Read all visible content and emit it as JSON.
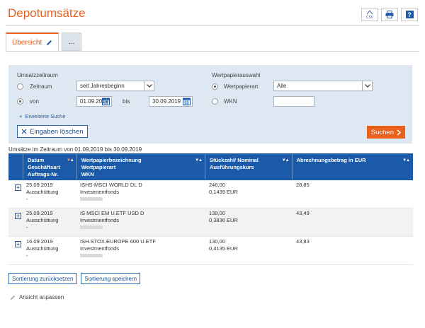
{
  "page": {
    "title": "Depotumsätze"
  },
  "toolbar": {
    "csv_label": "CSV"
  },
  "tabs": [
    {
      "label": "Übersicht"
    },
    {
      "label": "..."
    }
  ],
  "filter": {
    "period_label": "Umsatzzeitraum",
    "range_label": "Zeitraum",
    "range_value": "seit Jahresbeginn",
    "from_label": "von",
    "from_value": "01.09.2019",
    "to_label": "bis",
    "to_value": "30.09.2019",
    "security_label": "Wertpapierauswahl",
    "security_type_label": "Wertpapierart",
    "security_type_value": "Alle",
    "wkn_label": "WKN",
    "wkn_value": "",
    "extended_search": "Erweiterte Suche",
    "clear_label": "Eingaben löschen",
    "search_label": "Suchen"
  },
  "results": {
    "range_text": "Umsätze im Zeitraum von 01.09.2019 bis 30.09.2019"
  },
  "table": {
    "headers": [
      {
        "lines": [
          "Datum",
          "Geschäftsart",
          "Auftrags-Nr."
        ]
      },
      {
        "lines": [
          "Wertpapierbezeichnung",
          "Wertpapierart",
          "WKN"
        ]
      },
      {
        "lines": [
          "Stückzahl/ Nominal",
          "Ausführungskurs"
        ]
      },
      {
        "lines": [
          "Abrechnungsbetrag in EUR"
        ]
      }
    ],
    "rows": [
      {
        "date": "25.09.2019",
        "type": "Ausschüttung",
        "order": "-",
        "name": "ISHS-MSCI WORLD DL D",
        "security_type": "Investmentfonds",
        "qty": "246,00",
        "price": "0,1439 EUR",
        "amount": "28,85"
      },
      {
        "date": "25.09.2019",
        "type": "Ausschüttung",
        "order": "-",
        "name": "IS MSCI EM U.ETF USD D",
        "security_type": "Investmentfonds",
        "qty": "139,00",
        "price": "0,3836 EUR",
        "amount": "43,49"
      },
      {
        "date": "16.09.2019",
        "type": "Ausschüttung",
        "order": "-",
        "name": "ISH.STOX.EUROPE 600 U.ETF",
        "security_type": "Investmentfonds",
        "qty": "130,00",
        "price": "0,4135 EUR",
        "amount": "43,83"
      }
    ]
  },
  "actions": {
    "reset_sort": "Sortierung zurücksetzen",
    "save_sort": "Sortierung speichern",
    "adjust_view": "Ansicht anpassen"
  },
  "colors": {
    "accent": "#e8601c",
    "brand": "#1a5aa8",
    "panel": "#dde8f3"
  }
}
